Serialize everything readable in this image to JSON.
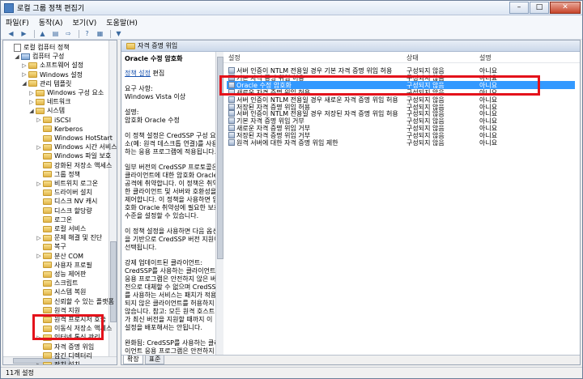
{
  "window": {
    "title": "로컬 그룹 정책 편집기",
    "minimize": "–",
    "maximize": "□",
    "close": "✕"
  },
  "menu": [
    "파일(F)",
    "동작(A)",
    "보기(V)",
    "도움말(H)"
  ],
  "toolbar_icons": [
    "back-icon",
    "forward-icon",
    "up-folder-icon",
    "show-hide-tree-icon",
    "export-icon",
    "help-icon",
    "filter-icon"
  ],
  "tree": [
    {
      "label": "로컬 컴퓨터 정책",
      "level": 0,
      "expander": "",
      "icon": "doc"
    },
    {
      "label": "컴퓨터 구성",
      "level": 1,
      "expander": "◢",
      "icon": "pc"
    },
    {
      "label": "소프트웨어 설정",
      "level": 2,
      "expander": "▷",
      "icon": "folder"
    },
    {
      "label": "Windows 설정",
      "level": 2,
      "expander": "▷",
      "icon": "folder"
    },
    {
      "label": "관리 템플릿",
      "level": 2,
      "expander": "◢",
      "icon": "folder"
    },
    {
      "label": "Windows 구성 요소",
      "level": 3,
      "expander": "▷",
      "icon": "folder"
    },
    {
      "label": "네트워크",
      "level": 3,
      "expander": "▷",
      "icon": "folder"
    },
    {
      "label": "시스템",
      "level": 3,
      "expander": "◢",
      "icon": "folder"
    },
    {
      "label": "iSCSI",
      "level": 4,
      "expander": "▷",
      "icon": "folder"
    },
    {
      "label": "Kerberos",
      "level": 4,
      "expander": "",
      "icon": "folder"
    },
    {
      "label": "Windows HotStart",
      "level": 4,
      "expander": "",
      "icon": "folder"
    },
    {
      "label": "Windows 시간 서비스",
      "level": 4,
      "expander": "▷",
      "icon": "folder"
    },
    {
      "label": "Windows 파일 보호",
      "level": 4,
      "expander": "",
      "icon": "folder"
    },
    {
      "label": "강화된 저장소 액세스",
      "level": 4,
      "expander": "",
      "icon": "folder"
    },
    {
      "label": "그룹 정책",
      "level": 4,
      "expander": "",
      "icon": "folder"
    },
    {
      "label": "비트위치 로그온",
      "level": 4,
      "expander": "▷",
      "icon": "folder"
    },
    {
      "label": "드라이버 설치",
      "level": 4,
      "expander": "",
      "icon": "folder"
    },
    {
      "label": "디스크 NV 캐시",
      "level": 4,
      "expander": "",
      "icon": "folder"
    },
    {
      "label": "디스크 할당량",
      "level": 4,
      "expander": "",
      "icon": "folder"
    },
    {
      "label": "로그온",
      "level": 4,
      "expander": "",
      "icon": "folder"
    },
    {
      "label": "로컬 서비스",
      "level": 4,
      "expander": "",
      "icon": "folder"
    },
    {
      "label": "문제 해결 및 진단",
      "level": 4,
      "expander": "▷",
      "icon": "folder"
    },
    {
      "label": "복구",
      "level": 4,
      "expander": "",
      "icon": "folder"
    },
    {
      "label": "분산 COM",
      "level": 4,
      "expander": "▷",
      "icon": "folder"
    },
    {
      "label": "사용자 프로필",
      "level": 4,
      "expander": "",
      "icon": "folder"
    },
    {
      "label": "성능 제어판",
      "level": 4,
      "expander": "",
      "icon": "folder"
    },
    {
      "label": "스크립트",
      "level": 4,
      "expander": "",
      "icon": "folder"
    },
    {
      "label": "시스템 복원",
      "level": 4,
      "expander": "",
      "icon": "folder"
    },
    {
      "label": "신뢰할 수 있는 플랫폼",
      "level": 4,
      "expander": "",
      "icon": "folder"
    },
    {
      "label": "원격 지원",
      "level": 4,
      "expander": "",
      "icon": "folder"
    },
    {
      "label": "원격 프로시저 호출",
      "level": 4,
      "expander": "",
      "icon": "folder"
    },
    {
      "label": "이동식 저장소 액세스",
      "level": 4,
      "expander": "",
      "icon": "folder"
    },
    {
      "label": "인터넷 통신 관리",
      "level": 4,
      "expander": "▷",
      "icon": "folder"
    },
    {
      "label": "자격 증명 위임",
      "level": 4,
      "expander": "",
      "icon": "folder"
    },
    {
      "label": "잠긴 디렉터리",
      "level": 4,
      "expander": "",
      "icon": "folder"
    },
    {
      "label": "장치 설치",
      "level": 4,
      "expander": "▷",
      "icon": "folder"
    },
    {
      "label": "전원 관리",
      "level": 4,
      "expander": "▷",
      "icon": "folder"
    }
  ],
  "right_header": "자격 증명 위임",
  "description": {
    "title": "Oracle 수정 암호화",
    "edit_link": "정책 설정",
    "edit_suffix": " 편집",
    "requirements_label": "요구 사항:",
    "requirements_value": "Windows Vista 이상",
    "desc_label": "설명:",
    "desc_value": "암호화 Oracle 수정",
    "para1": "이 정책 설정은 CredSSP 구성 요소(예: 원격 데스크톱 연결)를 사용하는 응용 프로그램에 적용됩니다.",
    "para2": "일부 버전의 CredSSP 프로토콜은 클라이언트에 대한 암호화 Oracle 공격에 취약합니다. 이 정책은 취약한 클라이언트 및 서버와 호환성을 제어합니다. 이 정책을 사용하면 암호화 Oracle 취약성에 필요한 보호 수준을 설정할 수 있습니다.",
    "para3": "이 정책 설정을 사용하면 다음 옵션을 기반으로 CredSSP 버전 지원이 선택됩니다.",
    "para4": "강제 업데이트된 클라이언트: CredSSP를 사용하는 클라이언트 응용 프로그램은 안전하지 않은 버전으로 대체할 수 없으며 CredSSP를 사용하는 서비스는 패치가 적용되지 않은 클라이언트를 허용하지 않습니다. 참고: 모든 원격 호스트가 최신 버전을 지원할 때까지 이 설정을 배포해서는 안됩니다.",
    "para5": "완화됨: CredSSP를 사용하는 클라이언트 응용 프로그램은 안전하지 않은 버전으로 대체할 수 없지만 CredSSP를 사용하는 서비스는 패치가 적용되지 않은 클라이언트를"
  },
  "columns": {
    "name": "설정",
    "state": "상태",
    "comment": "설명"
  },
  "policies": [
    {
      "name": "서버 인증이 NTLM 전용일 경우 기본 자격 증명 위임 허용",
      "state": "구성되지 않음",
      "comment": "아니요"
    },
    {
      "name": "기본 자격 증명 위임 허용",
      "state": "구성되지 않음",
      "comment": "아니요"
    },
    {
      "name": "Oracle 수정 암호화",
      "state": "구성되지 않음",
      "comment": "아니요"
    },
    {
      "name": "새로운 자격 증명 위임 허용",
      "state": "구성되지 않음",
      "comment": "아니요"
    },
    {
      "name": "서버 인증이 NTLM 전용일 경우 새로운 자격 증명 위임 허용",
      "state": "구성되지 않음",
      "comment": "아니요"
    },
    {
      "name": "저장된 자격 증명 위임 허용",
      "state": "구성되지 않음",
      "comment": "아니요"
    },
    {
      "name": "서버 인증이 NTLM 전용일 경우 저장된 자격 증명 위임 허용",
      "state": "구성되지 않음",
      "comment": "아니요"
    },
    {
      "name": "기본 자격 증명 위임 거부",
      "state": "구성되지 않음",
      "comment": "아니요"
    },
    {
      "name": "새로운 자격 증명 위임 거부",
      "state": "구성되지 않음",
      "comment": "아니요"
    },
    {
      "name": "저장된 자격 증명 위임 거부",
      "state": "구성되지 않음",
      "comment": "아니요"
    },
    {
      "name": "원격 서버에 대한 자격 증명 위임 제한",
      "state": "구성되지 않음",
      "comment": "아니요"
    }
  ],
  "tabs": {
    "extended": "확장",
    "standard": "표준"
  },
  "status": "11개 설정"
}
